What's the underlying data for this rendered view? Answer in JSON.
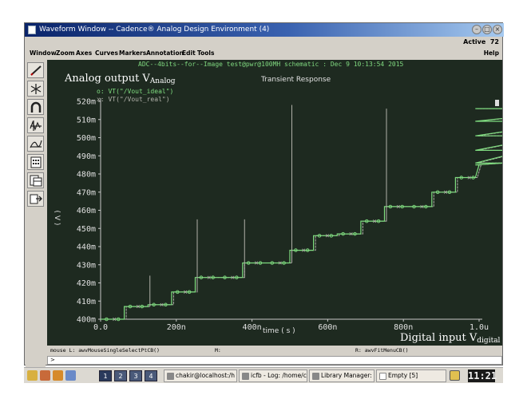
{
  "window": {
    "title": "Waveform Window -- Cadence® Analog Design Environment (4)",
    "status_label": "Active",
    "status_value": "72"
  },
  "menu": {
    "items": [
      "Window",
      "Zoom",
      "Axes",
      "Curves",
      "Markers",
      "Annotation",
      "Edit",
      "Tools"
    ],
    "help": "Help"
  },
  "toolbar": {
    "icons": [
      "pencil-icon",
      "snowflake-icon",
      "magnet-icon",
      "strip-chart-icon",
      "smooth-curve-icon",
      "calculator-icon",
      "table-icon",
      "export-icon"
    ]
  },
  "plot": {
    "header": "ADC--4bits--for--Image test@pwr@100MH schematic : Dec  9 10:13:54 2015",
    "subtitle": "Transient Response",
    "left_annotation": "Analog output V",
    "left_annotation_sub": "Analog",
    "right_annotation": "Digital input V",
    "right_annotation_sub": "digital",
    "legend": [
      {
        "marker": "o:",
        "label": "VT(\"/Vout_ideal\")"
      },
      {
        "marker": "x:",
        "label": "VT(\"/Vout_real\")"
      }
    ],
    "colors": {
      "background": "#1e2a20",
      "axis": "#c8c8c8",
      "ideal": "#7fdc7f",
      "real": "#b0b0a8",
      "text": "#e0e0e0",
      "header": "#7fd87f",
      "annotation": "#ffffff"
    }
  },
  "chart_data": {
    "type": "line",
    "title": "Transient Response",
    "xlabel": "time ( s )",
    "ylabel": "( V )",
    "xlim": [
      0.0,
      1.0
    ],
    "ylim": [
      400,
      520
    ],
    "x_ticks": [
      "0.0",
      "200n",
      "400n",
      "600n",
      "800n",
      "1.0u"
    ],
    "x_tick_values": [
      0.0,
      0.2,
      0.4,
      0.6,
      0.8,
      1.0
    ],
    "y_ticks": [
      "400m",
      "410m",
      "420m",
      "430m",
      "440m",
      "450m",
      "460m",
      "470m",
      "480m",
      "490m",
      "500m",
      "510m",
      "520m"
    ],
    "y_tick_values": [
      400,
      410,
      420,
      430,
      440,
      450,
      460,
      470,
      480,
      490,
      500,
      510,
      520
    ],
    "x_unit": "us",
    "y_unit": "mV",
    "step_width": 0.0625,
    "grid": false,
    "legend_position": "top-left",
    "series": [
      {
        "name": "VT(\"/Vout_ideal\")",
        "marker": "o",
        "values": [
          400,
          407,
          408,
          415,
          423,
          423,
          431,
          431,
          438,
          446,
          447,
          454,
          462,
          462,
          470,
          478,
          485,
          486,
          493,
          501,
          509,
          516
        ]
      },
      {
        "name": "VT(\"/Vout_real\")",
        "marker": "x",
        "values": [
          400,
          407,
          408,
          415,
          423,
          423,
          431,
          431,
          438,
          446,
          447,
          454,
          462,
          462,
          470,
          478,
          485,
          486,
          493,
          501,
          509,
          516
        ],
        "spikes": [
          {
            "x": 0.125,
            "to": 424
          },
          {
            "x": 0.25,
            "to": 455
          },
          {
            "x": 0.375,
            "to": 455
          },
          {
            "x": 0.5,
            "to": 518
          },
          {
            "x": 0.75,
            "to": 516
          }
        ]
      }
    ]
  },
  "bottom": {
    "left": "mouse L: awvMouseSingleSelectPtCB()",
    "mid": "M:",
    "right": "R: awvFitMenuCB()",
    "prompt": ">"
  },
  "taskbar": {
    "workspaces": [
      "1",
      "2",
      "3",
      "4"
    ],
    "tasks": [
      "chakir@localhost:/h",
      "icfb - Log: /home/ch",
      "Library Manager: W",
      "Empty [5]"
    ],
    "clock": "11:21"
  }
}
